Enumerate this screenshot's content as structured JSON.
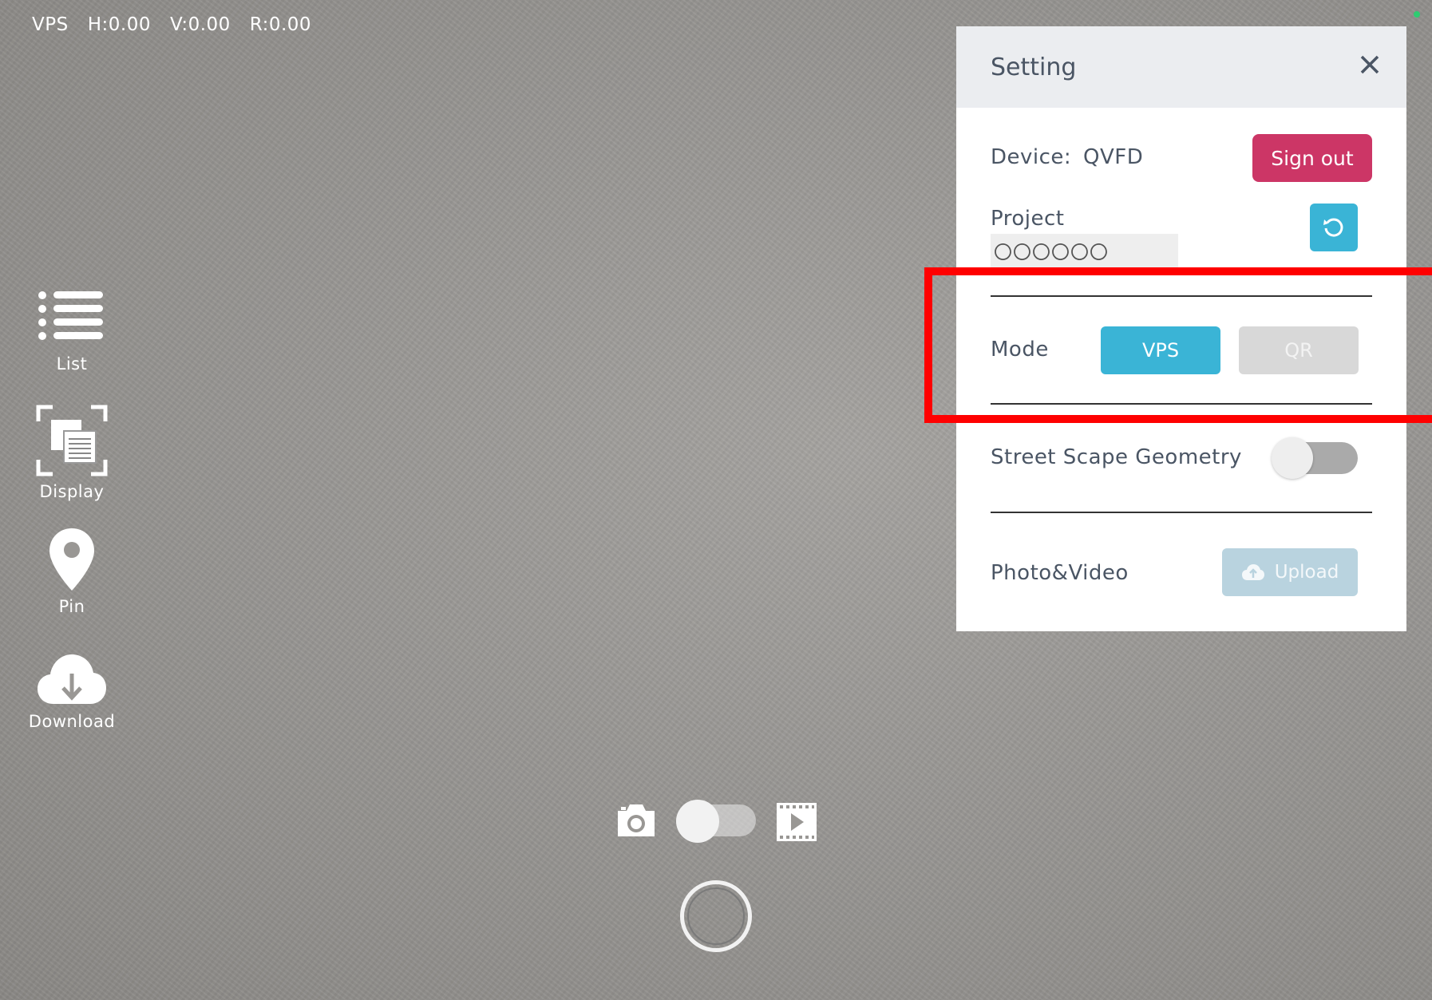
{
  "status": {
    "mode": "VPS",
    "h": "H:0.00",
    "v": "V:0.00",
    "r": "R:0.00"
  },
  "toolbar": {
    "list_label": "List",
    "display_label": "Display",
    "pin_label": "Pin",
    "download_label": "Download"
  },
  "setting": {
    "title": "Setting",
    "device_label": "Device:",
    "device_value": "QVFD",
    "signout_label": "Sign out",
    "project_label": "Project",
    "project_value": "〇〇〇〇〇〇",
    "mode_label": "Mode",
    "mode_options": [
      "VPS",
      "QR"
    ],
    "mode_selected": "VPS",
    "streetscape_label": "Street Scape Geometry",
    "streetscape_enabled": false,
    "photo_video_label": "Photo&Video",
    "upload_label": "Upload"
  },
  "capture": {
    "video_mode": false
  },
  "colors": {
    "accent": "#3ab4d6",
    "signout": "#cc3666",
    "highlight": "#ff0000",
    "upload_disabled": "#b9d3df"
  },
  "icons": {
    "list": "list-icon",
    "display": "display-scan-icon",
    "pin": "map-pin-icon",
    "download": "cloud-download-icon",
    "close": "close-icon",
    "refresh": "refresh-icon",
    "upload": "cloud-upload-icon",
    "camera": "camera-icon",
    "video": "film-play-icon"
  }
}
